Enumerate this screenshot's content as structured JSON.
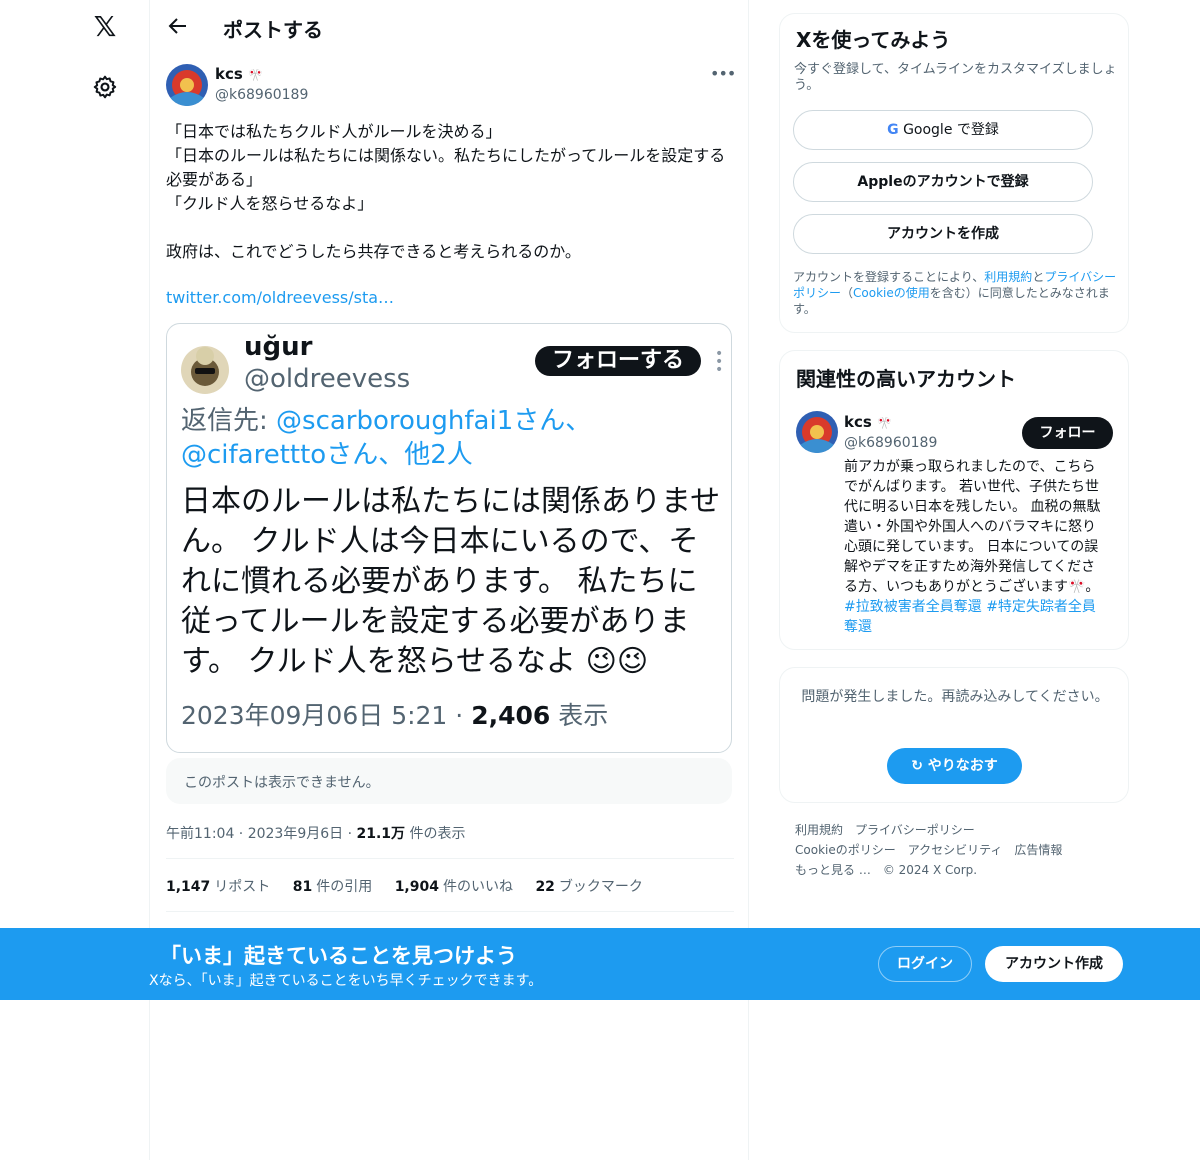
{
  "nav": {
    "logo_icon": "x-logo-icon",
    "settings_icon": "gear-icon"
  },
  "header": {
    "back_icon": "arrow-left-icon",
    "title": "ポストする"
  },
  "tweet": {
    "author_name": "kcs",
    "author_emoji": "🎌",
    "author_handle": "@k68960189",
    "text": "「日本では私たちクルド人がルールを決める」\n「日本のルールは私たちには関係ない。私たちにしたがってルールを設定する必要がある」\n「クルド人を怒らせるなよ」\n\n政府は、これでどうしたら共存できると考えられるのか。",
    "link": "twitter.com/oldreevess/sta…",
    "embed": {
      "name": "uğur",
      "handle": "@oldreevess",
      "follow_label": "フォローする",
      "reply_prefix": "返信先: ",
      "reply_users": "@scarboroughfai1さん、@cifaretttoさん、他2人",
      "body": "日本のルールは私たちには関係ありません。 クルド人は今日本にいるので、それに慣れる必要があります。 私たちに従ってルールを設定する必要があります。 クルド人を怒らせるなよ 😉😉",
      "date": "2023年09月06日 5:21 · ",
      "views_count": "2,406",
      "views_label": " 表示"
    },
    "unavailable": "このポストは表示できません。",
    "time": "午前11:04 · 2023年9月6日 · ",
    "views_count": "21.1万",
    "views_label": " 件の表示",
    "stats": [
      {
        "count": "1,147",
        "label": "リポスト"
      },
      {
        "count": "81",
        "label": "件の引用"
      },
      {
        "count": "1,904",
        "label": "件のいいね"
      },
      {
        "count": "22",
        "label": "ブックマーク"
      }
    ]
  },
  "signup": {
    "title": "Xを使ってみよう",
    "subtitle": "今すぐ登録して、タイムラインをカスタマイズしましょう。",
    "google": "Google で登録",
    "apple": "Appleのアカウントで登録",
    "create": "アカウントを作成",
    "legal_pre": "アカウントを登録することにより、",
    "legal_terms": "利用規約",
    "legal_and": "と",
    "legal_privacy": "プライバシーポリシー",
    "legal_mid": "（",
    "legal_cookie": "Cookieの使用",
    "legal_post": "を含む）に同意したとみなされます。"
  },
  "related": {
    "title": "関連性の高いアカウント",
    "name": "kcs",
    "emoji": "🎌",
    "handle": "@k68960189",
    "follow": "フォロー",
    "bio": "前アカが乗っ取られましたので、こちらでがんばります。 若い世代、子供たち世代に明るい日本を残したい。 血税の無駄遣い・外国や外国人へのバラマキに怒り心頭に発しています。 日本についての誤解やデマを正すため海外発信してくださる方、いつもありがとうございます🎌。 ",
    "hashtag1": "#拉致被害者全員奪還",
    "hashtag2": "#特定失踪者全員奪還"
  },
  "error": {
    "message": "問題が発生しました。再読み込みしてください。",
    "retry": "やりなおす"
  },
  "footer": {
    "links": [
      "利用規約",
      "プライバシーポリシー",
      "Cookieのポリシー",
      "アクセシビリティ",
      "広告情報",
      "もっと見る …",
      "© 2024 X Corp."
    ]
  },
  "banner": {
    "title": "「いま」起きていることを見つけよう",
    "subtitle": "Xなら、「いま」起きていることをいち早くチェックできます。",
    "login": "ログイン",
    "signup": "アカウント作成"
  },
  "colors": {
    "accent": "#1d9bf0",
    "text": "#0f1419",
    "muted": "#536471",
    "border": "#eff3f4"
  }
}
